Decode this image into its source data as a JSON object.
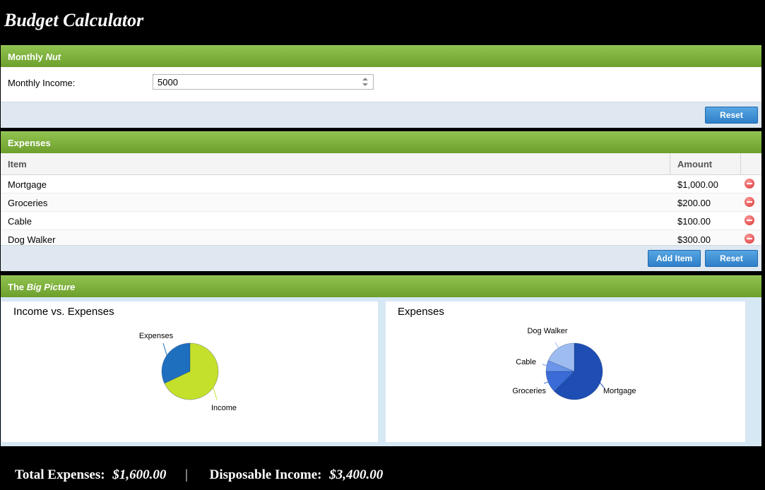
{
  "app_title": "Budget Calculator",
  "monthly_nut": {
    "header_prefix": "Monthly",
    "header_em": "Nut",
    "income_label": "Monthly Income:",
    "income_value": "5000",
    "reset_label": "Reset"
  },
  "expenses": {
    "header": "Expenses",
    "columns": {
      "item": "Item",
      "amount": "Amount"
    },
    "rows": [
      {
        "item": "Mortgage",
        "amount": "$1,000.00"
      },
      {
        "item": "Groceries",
        "amount": "$200.00"
      },
      {
        "item": "Cable",
        "amount": "$100.00"
      },
      {
        "item": "Dog Walker",
        "amount": "$300.00"
      }
    ],
    "add_label": "Add Item",
    "reset_label": "Reset"
  },
  "big_picture": {
    "header_prefix": "The",
    "header_em": "Big Picture",
    "income_chart_title": "Income vs. Expenses",
    "expenses_chart_title": "Expenses"
  },
  "chart_data": [
    {
      "type": "pie",
      "title": "Income vs. Expenses",
      "categories": [
        "Expenses",
        "Income"
      ],
      "values": [
        1600,
        3400
      ],
      "colors": [
        "#1f6fbf",
        "#c5e02a"
      ]
    },
    {
      "type": "pie",
      "title": "Expenses",
      "categories": [
        "Mortgage",
        "Groceries",
        "Cable",
        "Dog Walker"
      ],
      "values": [
        1000,
        200,
        100,
        300
      ],
      "colors": [
        "#1e4db3",
        "#3a6bd6",
        "#6b95e8",
        "#9fbcf0"
      ]
    }
  ],
  "footer": {
    "total_label": "Total Expenses:",
    "total_value": "$1,600.00",
    "separator": "|",
    "disposable_label": "Disposable Income:",
    "disposable_value": "$3,400.00"
  },
  "colors": {
    "header_green": "#7ab03a",
    "button_blue": "#3b8fd6",
    "toolbar_bg": "#dfe8f1",
    "delete_red": "#e04848"
  }
}
